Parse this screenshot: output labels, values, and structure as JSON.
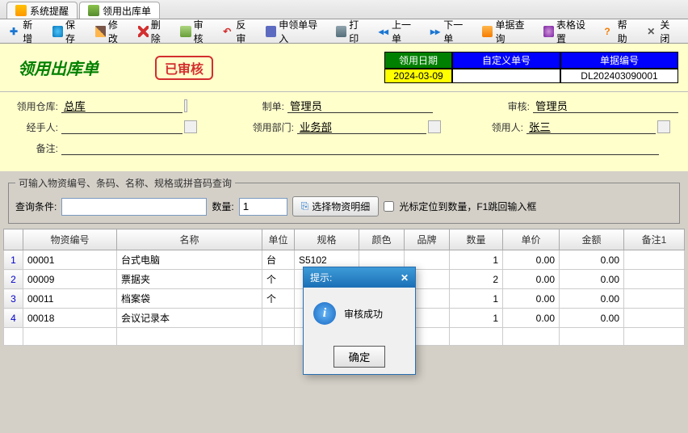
{
  "tabs": [
    {
      "label": "系统提醒"
    },
    {
      "label": "领用出库单"
    }
  ],
  "toolbar": {
    "add": "新增",
    "save": "保存",
    "edit": "修改",
    "delete": "删除",
    "audit": "审核",
    "unaudit": "反审",
    "import": "申领单导入",
    "print": "打印",
    "prev": "上一单",
    "next": "下一单",
    "query": "单据查询",
    "setting": "表格设置",
    "help": "帮助",
    "close": "关闭"
  },
  "header": {
    "title": "领用出库单",
    "stamp": "已审核",
    "meta": {
      "date_label": "领用日期",
      "date_value": "2024-03-09",
      "custom_label": "自定义单号",
      "custom_value": "",
      "docno_label": "单据编号",
      "docno_value": "DL202403090001"
    }
  },
  "form": {
    "warehouse_label": "领用仓库:",
    "warehouse_value": "总库",
    "maker_label": "制单:",
    "maker_value": "管理员",
    "auditor_label": "审核:",
    "auditor_value": "管理员",
    "handler_label": "经手人:",
    "handler_value": "",
    "dept_label": "领用部门:",
    "dept_value": "业务部",
    "receiver_label": "领用人:",
    "receiver_value": "张三",
    "remark_label": "备注:",
    "remark_value": ""
  },
  "search": {
    "legend": "可输入物资编号、条码、名称、规格或拼音码查询",
    "cond_label": "查询条件:",
    "cond_value": "",
    "qty_label": "数量:",
    "qty_value": "1",
    "select_btn": "选择物资明细",
    "cursor_hint": "光标定位到数量，F1跳回输入框"
  },
  "table": {
    "headers": [
      "",
      "物资编号",
      "名称",
      "单位",
      "规格",
      "颜色",
      "品牌",
      "数量",
      "单价",
      "金额",
      "备注1"
    ],
    "rows": [
      {
        "n": "1",
        "code": "00001",
        "name": "台式电脑",
        "unit": "台",
        "spec": "S5102",
        "color": "",
        "brand": "",
        "qty": "1",
        "price": "0.00",
        "amount": "0.00",
        "r1": ""
      },
      {
        "n": "2",
        "code": "00009",
        "name": "票据夹",
        "unit": "个",
        "spec": "",
        "color": "",
        "brand": "",
        "qty": "2",
        "price": "0.00",
        "amount": "0.00",
        "r1": ""
      },
      {
        "n": "3",
        "code": "00011",
        "name": "档案袋",
        "unit": "个",
        "spec": "",
        "color": "",
        "brand": "",
        "qty": "1",
        "price": "0.00",
        "amount": "0.00",
        "r1": ""
      },
      {
        "n": "4",
        "code": "00018",
        "name": "会议记录本",
        "unit": "",
        "spec": "",
        "color": "",
        "brand": "",
        "qty": "1",
        "price": "0.00",
        "amount": "0.00",
        "r1": ""
      }
    ]
  },
  "dialog": {
    "title": "提示:",
    "message": "审核成功",
    "ok": "确定"
  }
}
